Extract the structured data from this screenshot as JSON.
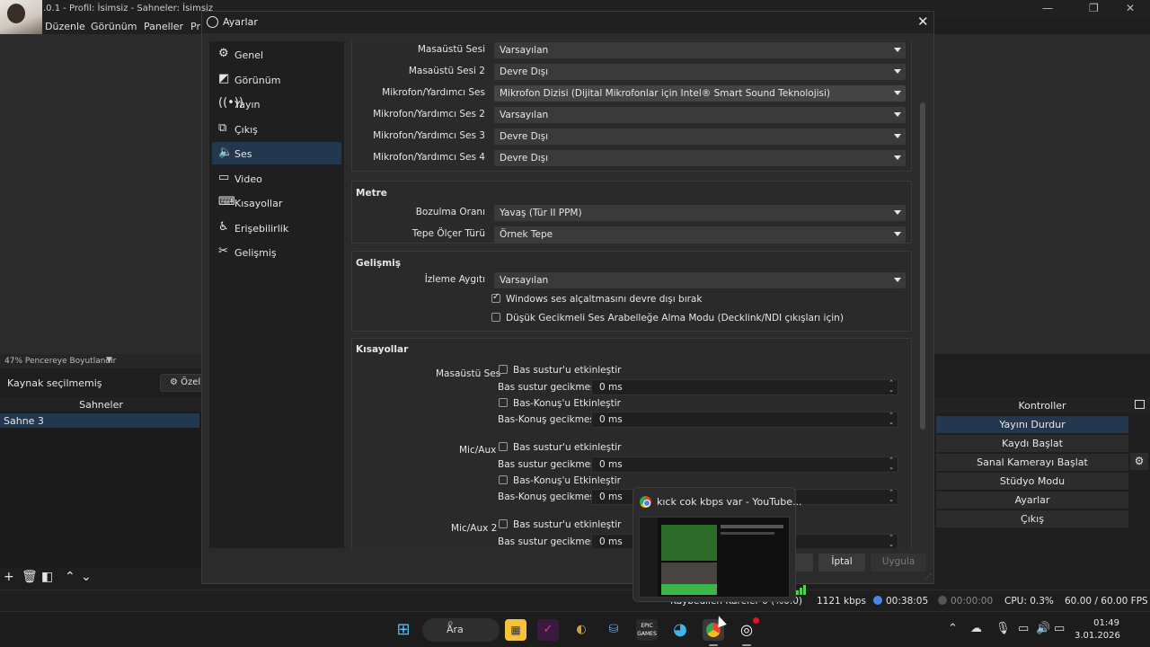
{
  "main_window": {
    "title": ".0.1 - Profil: İsimsiz - Sahneler: İsimsiz",
    "menu": [
      "Düzenle",
      "Görünüm",
      "Paneller",
      "Pr"
    ],
    "zoom_label": "47% Pencereye Boyutlandır",
    "source_status": "Kaynak seçilmemiş",
    "filters_button": "Özel",
    "scenes_header": "Sahneler",
    "scenes": [
      "Sahne 3"
    ],
    "controls": {
      "header": "Kontroller",
      "stop_stream": "Yayını Durdur",
      "start_recording": "Kaydı Başlat",
      "start_virtual_cam": "Sanal Kamerayı Başlat",
      "studio_mode": "Stüdyo Modu",
      "settings": "Ayarlar",
      "exit": "Çıkış"
    },
    "status": {
      "dropped_frames": "Kaybedilen Kareler 0 (%0.0)",
      "bitrate": "1121 kbps",
      "stream_time": "00:38:05",
      "record_time": "00:00:00",
      "cpu": "CPU: 0.3%",
      "fps": "60.00 / 60.00 FPS"
    }
  },
  "dialog": {
    "title": "Ayarlar",
    "nav": [
      {
        "label": "Genel",
        "icon": "gear-icon"
      },
      {
        "label": "Görünüm",
        "icon": "appearance-icon"
      },
      {
        "label": "Yayın",
        "icon": "broadcast-icon"
      },
      {
        "label": "Çıkış",
        "icon": "output-icon"
      },
      {
        "label": "Ses",
        "icon": "speaker-icon"
      },
      {
        "label": "Video",
        "icon": "monitor-icon"
      },
      {
        "label": "Kısayollar",
        "icon": "keyboard-icon"
      },
      {
        "label": "Erişebilirlik",
        "icon": "accessibility-icon"
      },
      {
        "label": "Gelişmiş",
        "icon": "tools-icon"
      }
    ],
    "active_nav": "Ses",
    "devices": [
      {
        "label": "Masaüstü Sesi",
        "value": "Varsayılan"
      },
      {
        "label": "Masaüstü Sesi 2",
        "value": "Devre Dışı"
      },
      {
        "label": "Mikrofon/Yardımcı Ses",
        "value": "Mikrofon Dizisi (Dijital Mikrofonlar için Intel® Smart Sound Teknolojisi)"
      },
      {
        "label": "Mikrofon/Yardımcı Ses 2",
        "value": "Varsayılan"
      },
      {
        "label": "Mikrofon/Yardımcı Ses 3",
        "value": "Devre Dışı"
      },
      {
        "label": "Mikrofon/Yardımcı Ses 4",
        "value": "Devre Dışı"
      }
    ],
    "meters": {
      "title": "Metre",
      "decay_label": "Bozulma Oranı",
      "decay_value": "Yavaş (Tür II PPM)",
      "peak_label": "Tepe Ölçer Türü",
      "peak_value": "Örnek Tepe"
    },
    "advanced": {
      "title": "Gelişmiş",
      "monitor_label": "İzleme Aygıtı",
      "monitor_value": "Varsayılan",
      "ducking_label": "Windows ses alçaltmasını devre dışı bırak",
      "ducking_checked": true,
      "low_latency_label": "Düşük Gecikmeli Ses Arabelleğe Alma Modu (Decklink/NDI çıkışları için)",
      "low_latency_checked": false
    },
    "hotkeys": {
      "title": "Kısayollar",
      "groups": [
        {
          "name": "Masaüstü Ses",
          "mute_enable": "Bas sustur'u etkinleştir",
          "mute_delay_label": "Bas sustur gecikmesi",
          "mute_delay": "0 ms",
          "ptt_enable": "Bas-Konuş'u Etkinleştir",
          "ptt_delay_label": "Bas-Konuş gecikmesi",
          "ptt_delay": "0 ms"
        },
        {
          "name": "Mic/Aux",
          "mute_enable": "Bas sustur'u etkinleştir",
          "mute_delay_label": "Bas sustur gecikmesi",
          "mute_delay": "0 ms",
          "ptt_enable": "Bas-Konuş'u Etkinleştir",
          "ptt_delay_label": "Bas-Konuş gecikmesi",
          "ptt_delay": "0 ms"
        },
        {
          "name": "Mic/Aux 2",
          "mute_enable": "Bas sustur'u etkinleştir",
          "mute_delay_label": "Bas sustur gecikmesi",
          "mute_delay": "0 ms"
        }
      ]
    },
    "buttons": {
      "ok_partial": "n",
      "cancel": "İptal",
      "apply": "Uygula"
    }
  },
  "thumbnail": {
    "title": "kıck cok kbps var - YouTube..."
  },
  "taskbar": {
    "search": "Ara",
    "time": "01:49",
    "date": "3.01.2026",
    "epic_label": "EPIC GAMES"
  }
}
